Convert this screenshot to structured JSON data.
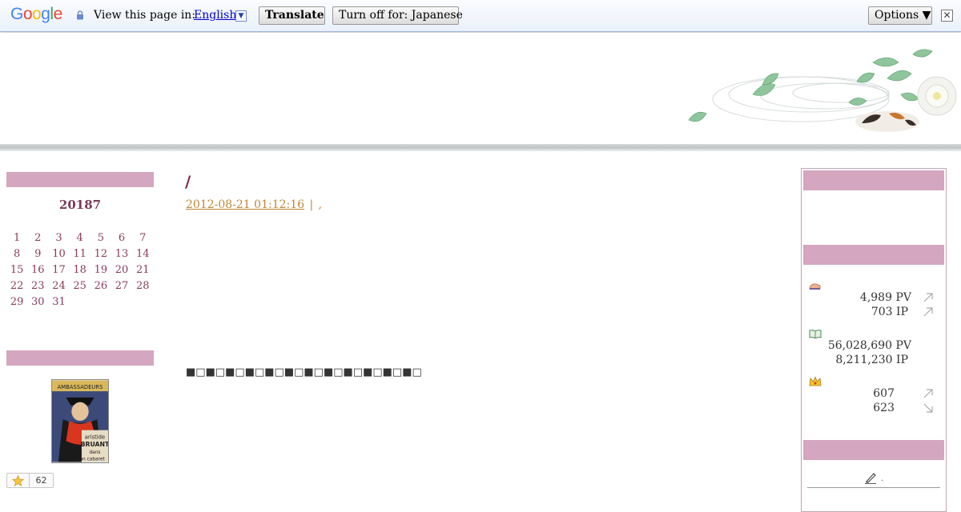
{
  "translate_bar": {
    "logo_letters": [
      {
        "ch": "G",
        "color": "#4285f4"
      },
      {
        "ch": "o",
        "color": "#ea4335"
      },
      {
        "ch": "o",
        "color": "#fbbc05"
      },
      {
        "ch": "g",
        "color": "#4285f4"
      },
      {
        "ch": "l",
        "color": "#34a853"
      },
      {
        "ch": "e",
        "color": "#ea4335"
      }
    ],
    "view_label": "View this page in:",
    "language": "English",
    "dropdown_glyph": "▼",
    "translate_label": "Translate",
    "turn_off_label": "Turn off for: Japanese",
    "options_label": "Options ▼",
    "close_glyph": "✕"
  },
  "calendar": {
    "title": "20187",
    "days": [
      "1",
      "2",
      "3",
      "4",
      "5",
      "6",
      "7",
      "8",
      "9",
      "10",
      "11",
      "12",
      "13",
      "14",
      "15",
      "16",
      "17",
      "18",
      "19",
      "20",
      "21",
      "22",
      "23",
      "24",
      "25",
      "26",
      "27",
      "28",
      "29",
      "30",
      "31"
    ]
  },
  "star_widget": {
    "count": "62"
  },
  "post": {
    "title": "/",
    "timestamp": "2012-08-21 01:12:16",
    "separator": "|",
    "trailing": ",",
    "squares": "■□■□■□■□■□■□■□■□■□■□■□■□"
  },
  "access_stats": {
    "today_pv": "4,989",
    "today_pv_unit": "PV",
    "today_ip": "703",
    "today_ip_unit": "IP",
    "total_pv": "56,028,690",
    "total_pv_unit": "PV",
    "total_ip": "8,211,230",
    "total_ip_unit": "IP",
    "rank_1": "607",
    "rank_2": "623"
  },
  "pen_row": {
    "trailing": "."
  },
  "colors": {
    "sidebar_header": "#d4a6bf",
    "title": "#7a2a48",
    "link": "#c0883a"
  }
}
